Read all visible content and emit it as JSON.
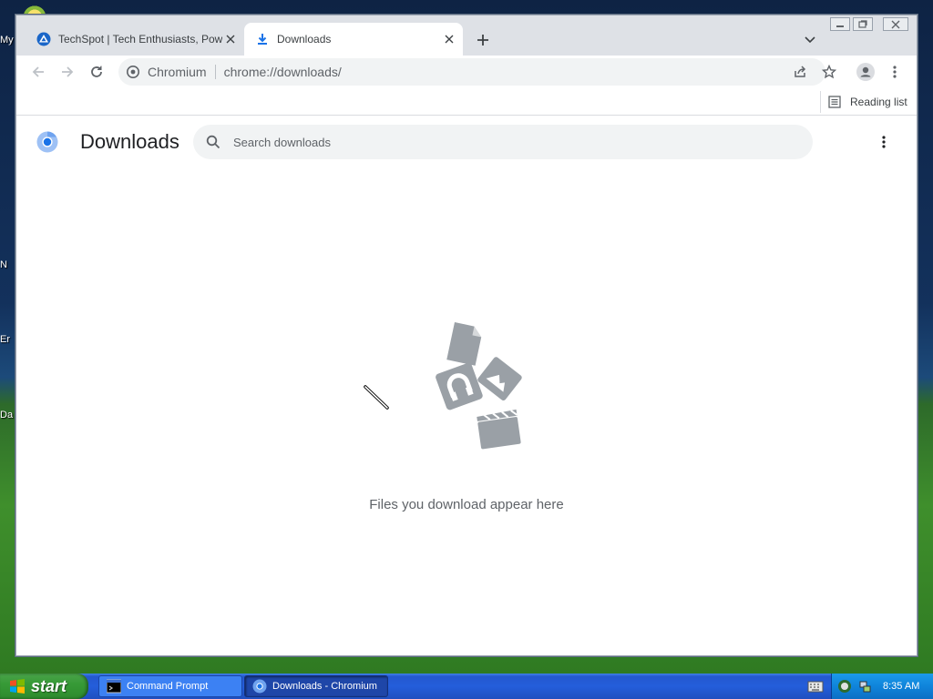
{
  "desktop": {
    "icon_labels": [
      "My",
      "N",
      "Er",
      "Da"
    ]
  },
  "browser": {
    "tabs": [
      {
        "title": "TechSpot | Tech Enthusiasts, Power",
        "active": false,
        "icon": "techspot-favicon"
      },
      {
        "title": "Downloads",
        "active": true,
        "icon": "download-icon"
      }
    ],
    "newtab_label": "+",
    "omnibox": {
      "site_name": "Chromium",
      "url": "chrome://downloads/"
    },
    "bookmarks": {
      "reading_list_label": "Reading list"
    }
  },
  "page": {
    "title": "Downloads",
    "search": {
      "placeholder": "Search downloads",
      "value": ""
    },
    "empty_message": "Files you download appear here"
  },
  "taskbar": {
    "start_label": "start",
    "items": [
      {
        "label": "Command Prompt",
        "active": false
      },
      {
        "label": "Downloads - Chromium",
        "active": true
      }
    ],
    "clock": "8:35 AM"
  },
  "colors": {
    "accent_blue": "#1a73e8",
    "illustration_gray": "#9aa0a6",
    "xp_taskbar": "#245edb",
    "xp_start_green": "#379a37"
  }
}
